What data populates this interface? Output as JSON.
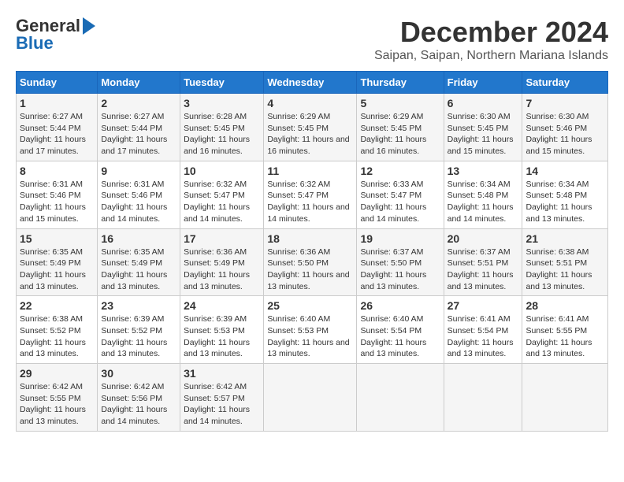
{
  "logo": {
    "line1": "General",
    "line2": "Blue"
  },
  "title": "December 2024",
  "subtitle": "Saipan, Saipan, Northern Mariana Islands",
  "days_of_week": [
    "Sunday",
    "Monday",
    "Tuesday",
    "Wednesday",
    "Thursday",
    "Friday",
    "Saturday"
  ],
  "weeks": [
    [
      {
        "day": "1",
        "sunrise": "6:27 AM",
        "sunset": "5:44 PM",
        "daylight": "11 hours and 17 minutes."
      },
      {
        "day": "2",
        "sunrise": "6:27 AM",
        "sunset": "5:44 PM",
        "daylight": "11 hours and 17 minutes."
      },
      {
        "day": "3",
        "sunrise": "6:28 AM",
        "sunset": "5:45 PM",
        "daylight": "11 hours and 16 minutes."
      },
      {
        "day": "4",
        "sunrise": "6:29 AM",
        "sunset": "5:45 PM",
        "daylight": "11 hours and 16 minutes."
      },
      {
        "day": "5",
        "sunrise": "6:29 AM",
        "sunset": "5:45 PM",
        "daylight": "11 hours and 16 minutes."
      },
      {
        "day": "6",
        "sunrise": "6:30 AM",
        "sunset": "5:45 PM",
        "daylight": "11 hours and 15 minutes."
      },
      {
        "day": "7",
        "sunrise": "6:30 AM",
        "sunset": "5:46 PM",
        "daylight": "11 hours and 15 minutes."
      }
    ],
    [
      {
        "day": "8",
        "sunrise": "6:31 AM",
        "sunset": "5:46 PM",
        "daylight": "11 hours and 15 minutes."
      },
      {
        "day": "9",
        "sunrise": "6:31 AM",
        "sunset": "5:46 PM",
        "daylight": "11 hours and 14 minutes."
      },
      {
        "day": "10",
        "sunrise": "6:32 AM",
        "sunset": "5:47 PM",
        "daylight": "11 hours and 14 minutes."
      },
      {
        "day": "11",
        "sunrise": "6:32 AM",
        "sunset": "5:47 PM",
        "daylight": "11 hours and 14 minutes."
      },
      {
        "day": "12",
        "sunrise": "6:33 AM",
        "sunset": "5:47 PM",
        "daylight": "11 hours and 14 minutes."
      },
      {
        "day": "13",
        "sunrise": "6:34 AM",
        "sunset": "5:48 PM",
        "daylight": "11 hours and 14 minutes."
      },
      {
        "day": "14",
        "sunrise": "6:34 AM",
        "sunset": "5:48 PM",
        "daylight": "11 hours and 13 minutes."
      }
    ],
    [
      {
        "day": "15",
        "sunrise": "6:35 AM",
        "sunset": "5:49 PM",
        "daylight": "11 hours and 13 minutes."
      },
      {
        "day": "16",
        "sunrise": "6:35 AM",
        "sunset": "5:49 PM",
        "daylight": "11 hours and 13 minutes."
      },
      {
        "day": "17",
        "sunrise": "6:36 AM",
        "sunset": "5:49 PM",
        "daylight": "11 hours and 13 minutes."
      },
      {
        "day": "18",
        "sunrise": "6:36 AM",
        "sunset": "5:50 PM",
        "daylight": "11 hours and 13 minutes."
      },
      {
        "day": "19",
        "sunrise": "6:37 AM",
        "sunset": "5:50 PM",
        "daylight": "11 hours and 13 minutes."
      },
      {
        "day": "20",
        "sunrise": "6:37 AM",
        "sunset": "5:51 PM",
        "daylight": "11 hours and 13 minutes."
      },
      {
        "day": "21",
        "sunrise": "6:38 AM",
        "sunset": "5:51 PM",
        "daylight": "11 hours and 13 minutes."
      }
    ],
    [
      {
        "day": "22",
        "sunrise": "6:38 AM",
        "sunset": "5:52 PM",
        "daylight": "11 hours and 13 minutes."
      },
      {
        "day": "23",
        "sunrise": "6:39 AM",
        "sunset": "5:52 PM",
        "daylight": "11 hours and 13 minutes."
      },
      {
        "day": "24",
        "sunrise": "6:39 AM",
        "sunset": "5:53 PM",
        "daylight": "11 hours and 13 minutes."
      },
      {
        "day": "25",
        "sunrise": "6:40 AM",
        "sunset": "5:53 PM",
        "daylight": "11 hours and 13 minutes."
      },
      {
        "day": "26",
        "sunrise": "6:40 AM",
        "sunset": "5:54 PM",
        "daylight": "11 hours and 13 minutes."
      },
      {
        "day": "27",
        "sunrise": "6:41 AM",
        "sunset": "5:54 PM",
        "daylight": "11 hours and 13 minutes."
      },
      {
        "day": "28",
        "sunrise": "6:41 AM",
        "sunset": "5:55 PM",
        "daylight": "11 hours and 13 minutes."
      }
    ],
    [
      {
        "day": "29",
        "sunrise": "6:42 AM",
        "sunset": "5:55 PM",
        "daylight": "11 hours and 13 minutes."
      },
      {
        "day": "30",
        "sunrise": "6:42 AM",
        "sunset": "5:56 PM",
        "daylight": "11 hours and 14 minutes."
      },
      {
        "day": "31",
        "sunrise": "6:42 AM",
        "sunset": "5:57 PM",
        "daylight": "11 hours and 14 minutes."
      },
      null,
      null,
      null,
      null
    ]
  ]
}
